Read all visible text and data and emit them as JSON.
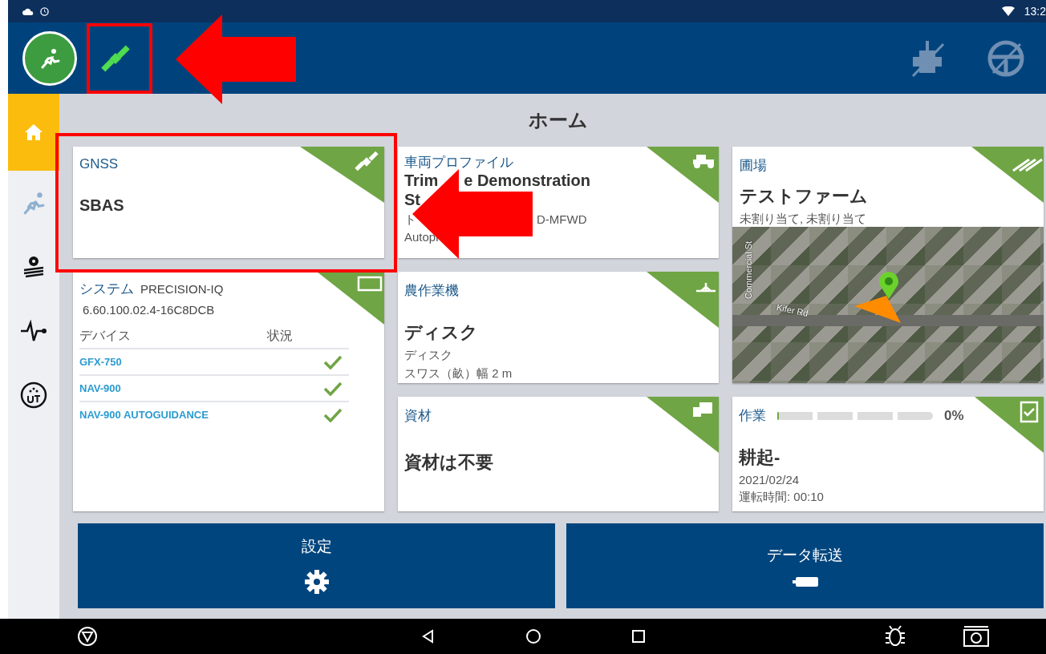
{
  "status_bar": {
    "time": "13:2"
  },
  "sidebar": {
    "items": [
      {
        "selected": true
      },
      {
        "selected": false
      },
      {
        "selected": false
      },
      {
        "selected": false
      },
      {
        "selected": false
      }
    ]
  },
  "page_title": "ホーム",
  "gnss": {
    "title": "GNSS",
    "value": "SBAS"
  },
  "vehicle": {
    "title": "車両プロファイル",
    "name_line_1": [
      "Trim",
      "e Demonstration"
    ],
    "name_line_2": "St",
    "type_parts": [
      "ト",
      "D-MFWD"
    ],
    "guidance": "Autopi"
  },
  "field": {
    "title": "圃場",
    "name": "テストファーム",
    "subtitle": "未割り当て, 未割り当て",
    "map_labels": [
      "Commercial St",
      "Kifer Rd"
    ]
  },
  "system": {
    "title": "システム",
    "product": "PRECISION-IQ",
    "version": "6.60.100.02.4-16C8DCB",
    "columns": [
      "デバイス",
      "状況"
    ],
    "devices": [
      {
        "name": "GFX-750",
        "ok": true
      },
      {
        "name": "NAV-900",
        "ok": true
      },
      {
        "name": "NAV-900 AUTOGUIDANCE",
        "ok": true
      }
    ]
  },
  "implement": {
    "title": "農作業機",
    "name": "ディスク",
    "type": "ディスク",
    "swath": "スワス（畝）幅 2 m"
  },
  "material": {
    "title": "資材",
    "value": "資材は不要"
  },
  "task": {
    "title": "作業",
    "level": 0,
    "percent": "0%",
    "name": "耕起-",
    "date": "2021/02/24",
    "runtime": "運転時間: 00:10"
  },
  "buttons": [
    {
      "kind": "settings",
      "label": "設定"
    },
    {
      "kind": "transfer",
      "label": "データ転送"
    }
  ]
}
